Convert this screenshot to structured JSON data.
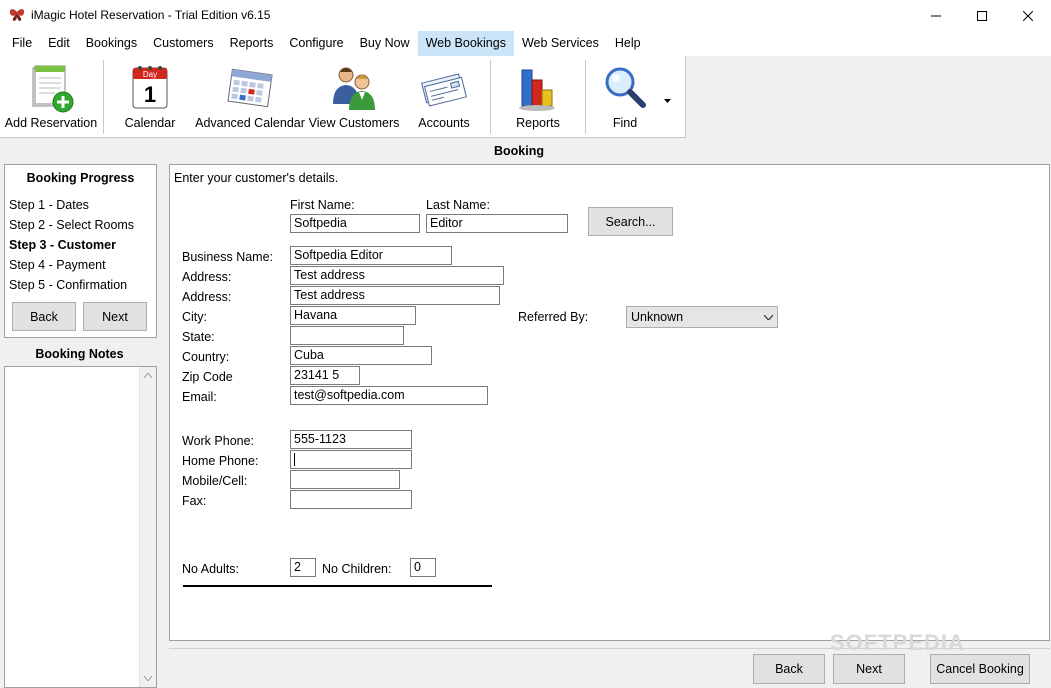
{
  "window": {
    "title": "iMagic Hotel Reservation - Trial Edition v6.15"
  },
  "menu": [
    "File",
    "Edit",
    "Bookings",
    "Customers",
    "Reports",
    "Configure",
    "Buy Now",
    "Web Bookings",
    "Web Services",
    "Help"
  ],
  "menu_active_index": 7,
  "toolbar": {
    "add_reservation": "Add Reservation",
    "calendar": "Calendar",
    "calendar_icon_day": "Day",
    "calendar_icon_num": "1",
    "advanced_calendar": "Advanced Calendar",
    "view_customers": "View Customers",
    "accounts": "Accounts",
    "reports": "Reports",
    "find": "Find"
  },
  "booking_header": "Booking",
  "progress": {
    "title": "Booking Progress",
    "steps": [
      "Step 1 - Dates",
      "Step 2 - Select Rooms",
      "Step 3 - Customer",
      "Step 4 - Payment",
      "Step 5 - Confirmation"
    ],
    "current_step_index": 2,
    "back_label": "Back",
    "next_label": "Next"
  },
  "notes": {
    "title": "Booking Notes"
  },
  "form": {
    "instructions": "Enter your customer's details.",
    "first_name_label": "First Name:",
    "first_name": "Softpedia",
    "last_name_label": "Last Name:",
    "last_name": "Editor",
    "search_label": "Search...",
    "business_name_label": "Business Name:",
    "business_name": "Softpedia Editor",
    "address_label": "Address:",
    "address1": "Test address",
    "address2": "Test address",
    "city_label": "City:",
    "city": "Havana",
    "state_label": "State:",
    "state": "",
    "country_label": "Country:",
    "country": "Cuba",
    "zip_label": "Zip Code",
    "zip": "23141 5",
    "email_label": "Email:",
    "email": "test@softpedia.com",
    "referred_by_label": "Referred By:",
    "referred_by": "Unknown",
    "work_phone_label": "Work Phone:",
    "work_phone": "555-1123",
    "home_phone_label": "Home Phone:",
    "home_phone": "",
    "mobile_label": "Mobile/Cell:",
    "mobile": "",
    "fax_label": "Fax:",
    "fax": "",
    "adults_label": "No Adults:",
    "adults": "2",
    "children_label": "No Children:",
    "children": "0"
  },
  "footer": {
    "back": "Back",
    "next": "Next",
    "cancel": "Cancel Booking"
  },
  "watermark": "SOFTPEDIA"
}
